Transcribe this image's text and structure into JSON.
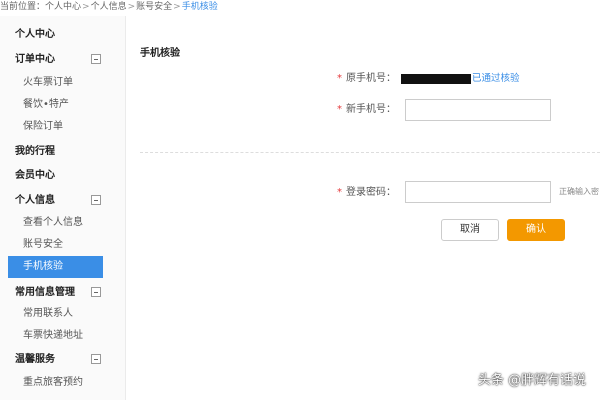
{
  "breadcrumb": {
    "prefix": "当前位置：",
    "items": [
      "个人中心",
      "个人信息",
      "账号安全"
    ],
    "separator": ">",
    "current": "手机核验"
  },
  "sidebar": {
    "groups": [
      {
        "label": "个人中心",
        "collapsible": false,
        "items": []
      },
      {
        "label": "订单中心",
        "collapsible": true,
        "items": [
          "火车票订单",
          "餐饮•特产",
          "保险订单"
        ]
      },
      {
        "label": "我的行程",
        "collapsible": false,
        "items": []
      },
      {
        "label": "会员中心",
        "collapsible": false,
        "items": []
      },
      {
        "label": "个人信息",
        "collapsible": true,
        "items": [
          "查看个人信息",
          "账号安全",
          "手机核验"
        ]
      },
      {
        "label": "常用信息管理",
        "collapsible": true,
        "items": [
          "常用联系人",
          "车票快递地址"
        ]
      },
      {
        "label": "温馨服务",
        "collapsible": true,
        "items": [
          "重点旅客预约"
        ]
      }
    ],
    "active_item": "手机核验"
  },
  "main": {
    "section_title": "手机核验",
    "required_mark": "*",
    "original_phone": {
      "label": "原手机号：",
      "status": "已通过核验"
    },
    "new_phone": {
      "label": "新手机号：",
      "value": ""
    },
    "password": {
      "label": "登录密码：",
      "value": "",
      "hint": "正确输入密"
    },
    "buttons": {
      "cancel": "取消",
      "confirm": "确认"
    }
  },
  "colors": {
    "accent": "#3a8ee6",
    "confirm": "#f39800",
    "required": "#e4393c"
  },
  "watermark": "头条 @胖辉有话说"
}
